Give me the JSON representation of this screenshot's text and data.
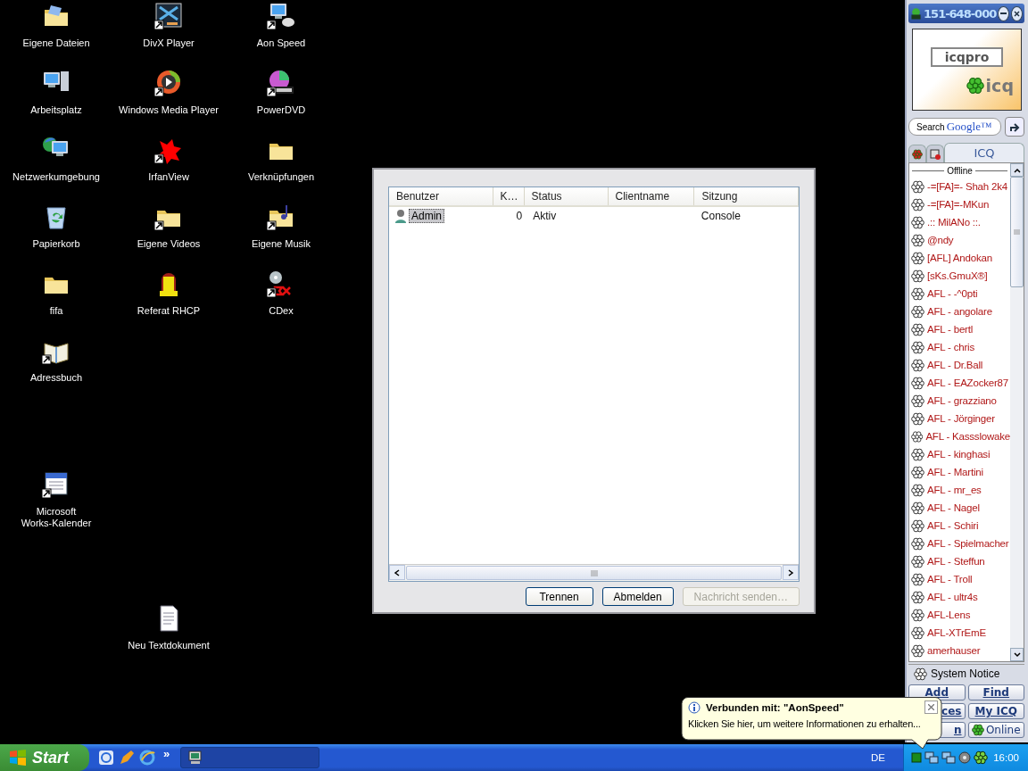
{
  "desktop_icons": [
    {
      "label": "Eigene Dateien",
      "kind": "doc-folder",
      "shortcut": false
    },
    {
      "label": "DivX Player",
      "kind": "video",
      "shortcut": true
    },
    {
      "label": "Aon Speed",
      "kind": "network-pc",
      "shortcut": true
    },
    {
      "label": "Arbeitsplatz",
      "kind": "computer",
      "shortcut": false
    },
    {
      "label": "Windows Media Player",
      "kind": "media",
      "shortcut": true
    },
    {
      "label": "PowerDVD",
      "kind": "disc-film",
      "shortcut": true
    },
    {
      "label": "Netzwerkumgebung",
      "kind": "globe",
      "shortcut": false
    },
    {
      "label": "IrfanView",
      "kind": "splash",
      "shortcut": true
    },
    {
      "label": "Verknüpfungen",
      "kind": "folder",
      "shortcut": false
    },
    {
      "label": "Papierkorb",
      "kind": "recycle",
      "shortcut": false
    },
    {
      "label": "Eigene Videos",
      "kind": "folder",
      "shortcut": true
    },
    {
      "label": "Eigene Musik",
      "kind": "music-folder",
      "shortcut": true
    },
    {
      "label": "fifa",
      "kind": "folder",
      "shortcut": false
    },
    {
      "label": "Referat RHCP",
      "kind": "figure",
      "shortcut": false
    },
    {
      "label": "CDex",
      "kind": "disc",
      "shortcut": true
    },
    {
      "label": "Adressbuch",
      "kind": "book",
      "shortcut": true
    },
    {
      "label": "Microsoft Works-Kalender",
      "kind": "calendar",
      "shortcut": true
    },
    {
      "label": "Neu Textdokument",
      "kind": "text-doc",
      "shortcut": false
    }
  ],
  "dialog": {
    "columns": [
      {
        "label": "Benutzer"
      },
      {
        "label": "K…"
      },
      {
        "label": "Status"
      },
      {
        "label": "Clientname"
      },
      {
        "label": "Sitzung"
      }
    ],
    "rows": [
      {
        "user": "Admin",
        "k": "0",
        "status": "Aktiv",
        "session": "Console",
        "selected": true
      }
    ],
    "buttons": [
      {
        "label": "Trennen",
        "disabled": false
      },
      {
        "label": "Abmelden",
        "disabled": false
      },
      {
        "label": "Nachricht senden…",
        "disabled": true
      }
    ]
  },
  "icq": {
    "title": "151-648-000",
    "banner": {
      "logo": "icqpro",
      "brand": "icq"
    },
    "search": {
      "label": "Search",
      "engine": "Google™"
    },
    "tabs": [
      {
        "kind": "flower",
        "selected": false
      },
      {
        "kind": "window",
        "selected": false
      },
      {
        "kind": "text",
        "label": "ICQ",
        "selected": true
      }
    ],
    "group": "Offline",
    "contacts": [
      {
        "name": "-=[FA]=- Shah 2k4"
      },
      {
        "name": "-=[FA]=-MKun"
      },
      {
        "name": ".:: MilANo ::."
      },
      {
        "name": "@ndy"
      },
      {
        "name": "[AFL] Andokan"
      },
      {
        "name": "[sKs.GmuX®]"
      },
      {
        "name": "AFL - -^0pti"
      },
      {
        "name": "AFL - angolare"
      },
      {
        "name": "AFL - bertl"
      },
      {
        "name": "AFL - chris"
      },
      {
        "name": "AFL - Dr.Ball"
      },
      {
        "name": "AFL - EAZocker87"
      },
      {
        "name": "AFL - grazziano"
      },
      {
        "name": "AFL - Jörginger"
      },
      {
        "name": "AFL - Kassslowake"
      },
      {
        "name": "AFL - kinghasi"
      },
      {
        "name": "AFL - Martini"
      },
      {
        "name": "AFL - mr_es"
      },
      {
        "name": "AFL - Nagel"
      },
      {
        "name": "AFL - Schiri"
      },
      {
        "name": "AFL - Spielmacher"
      },
      {
        "name": "AFL - Steffun"
      },
      {
        "name": "AFL - Troll"
      },
      {
        "name": "AFL - ultr4s"
      },
      {
        "name": "AFL-Lens"
      },
      {
        "name": "AFL-XTrEmE"
      },
      {
        "name": "amerhauser"
      }
    ],
    "system_notice": "System Notice",
    "buttons": [
      {
        "label": "Add",
        "kind": "link",
        "covered": false
      },
      {
        "label": "Find",
        "kind": "link",
        "covered": false
      },
      {
        "label": "ces",
        "kind": "link",
        "covered": true
      },
      {
        "label": "My ICQ",
        "kind": "link",
        "covered": false
      },
      {
        "label": "n",
        "kind": "link",
        "covered": true
      },
      {
        "label": "Online",
        "kind": "status",
        "covered": false
      }
    ]
  },
  "balloon": {
    "title": "Verbunden mit: \"AonSpeed\"",
    "text": "Klicken Sie hier, um weitere Informationen zu erhalten..."
  },
  "taskbar": {
    "start": "Start",
    "more": "»",
    "language": "DE",
    "clock": "16:00"
  }
}
